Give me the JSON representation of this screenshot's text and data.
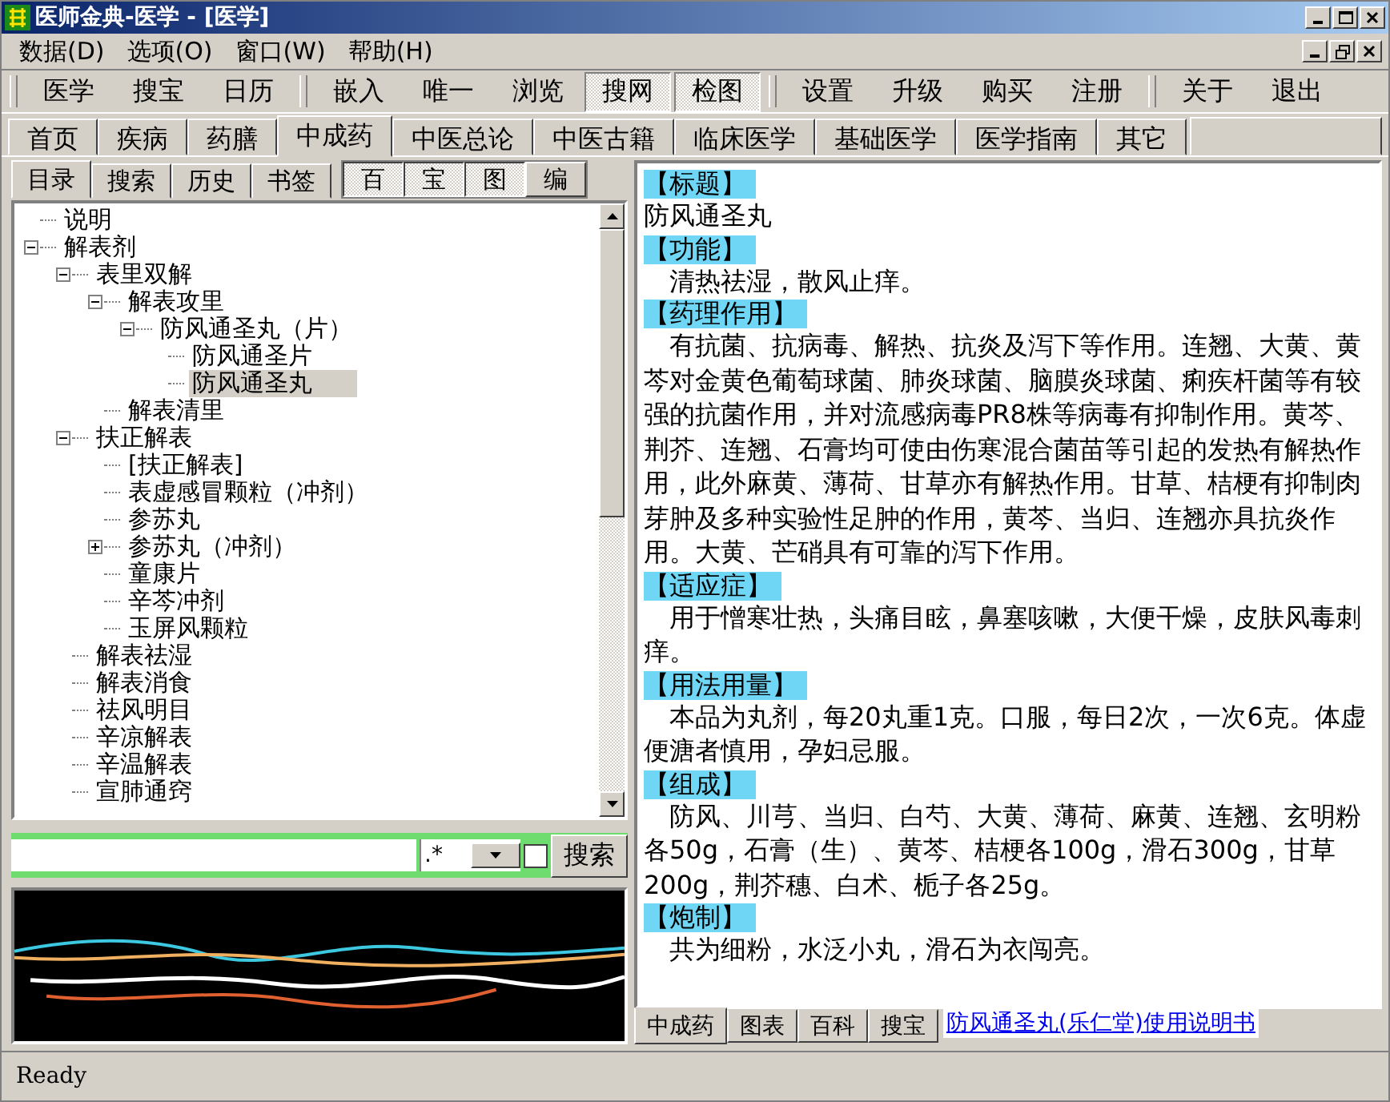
{
  "window": {
    "title": "医师金典-医学 - [医学]"
  },
  "menu": [
    "数据(D)",
    "选项(O)",
    "窗口(W)",
    "帮助(H)"
  ],
  "toolbar": {
    "groups": [
      {
        "buttons": [
          {
            "label": "医学",
            "pressed": false
          },
          {
            "label": "搜宝",
            "pressed": false
          },
          {
            "label": "日历",
            "pressed": false
          }
        ]
      },
      {
        "buttons": [
          {
            "label": "嵌入",
            "pressed": false
          },
          {
            "label": "唯一",
            "pressed": false
          },
          {
            "label": "浏览",
            "pressed": false
          },
          {
            "label": "搜网",
            "pressed": true
          },
          {
            "label": "检图",
            "pressed": true
          }
        ]
      },
      {
        "buttons": [
          {
            "label": "设置",
            "pressed": false
          },
          {
            "label": "升级",
            "pressed": false
          },
          {
            "label": "购买",
            "pressed": false
          },
          {
            "label": "注册",
            "pressed": false
          }
        ]
      },
      {
        "buttons": [
          {
            "label": "关于",
            "pressed": false
          },
          {
            "label": "退出",
            "pressed": false
          }
        ]
      }
    ]
  },
  "tabs": [
    {
      "label": "首页",
      "selected": false
    },
    {
      "label": "疾病",
      "selected": false
    },
    {
      "label": "药膳",
      "selected": false
    },
    {
      "label": "中成药",
      "selected": true
    },
    {
      "label": "中医总论",
      "selected": false
    },
    {
      "label": "中医古籍",
      "selected": false
    },
    {
      "label": "临床医学",
      "selected": false
    },
    {
      "label": "基础医学",
      "selected": false
    },
    {
      "label": "医学指南",
      "selected": false
    },
    {
      "label": "其它",
      "selected": false
    }
  ],
  "left_panel": {
    "tabs": [
      {
        "label": "目录",
        "selected": true
      },
      {
        "label": "搜索",
        "selected": false
      },
      {
        "label": "历史",
        "selected": false
      },
      {
        "label": "书签",
        "selected": false
      }
    ],
    "view_buttons": [
      {
        "label": "百",
        "pressed": true
      },
      {
        "label": "宝",
        "pressed": true
      },
      {
        "label": "图",
        "pressed": true
      },
      {
        "label": "编",
        "pressed": false
      }
    ],
    "tree": [
      {
        "label": "说明",
        "selected": false
      },
      {
        "label": "解表剂",
        "selected": false,
        "expanded": true,
        "children": [
          {
            "label": "表里双解",
            "selected": false,
            "expanded": true,
            "children": [
              {
                "label": "解表攻里",
                "selected": false,
                "expanded": true,
                "children": [
                  {
                    "label": "防风通圣丸（片）",
                    "selected": false,
                    "expanded": true,
                    "children": [
                      {
                        "label": "防风通圣片",
                        "selected": false
                      },
                      {
                        "label": "防风通圣丸",
                        "selected": true
                      }
                    ]
                  }
                ]
              },
              {
                "label": "解表清里",
                "selected": false
              }
            ]
          },
          {
            "label": "扶正解表",
            "selected": false,
            "expanded": true,
            "children": [
              {
                "label": "[扶正解表]",
                "selected": false
              },
              {
                "label": "表虚感冒颗粒（冲剂）",
                "selected": false
              },
              {
                "label": "参苏丸",
                "selected": false
              },
              {
                "label": "参苏丸（冲剂）",
                "selected": false,
                "expanded": false
              },
              {
                "label": "童康片",
                "selected": false
              },
              {
                "label": "辛芩冲剂",
                "selected": false
              },
              {
                "label": "玉屏风颗粒",
                "selected": false
              }
            ]
          },
          {
            "label": "解表祛湿",
            "selected": false
          },
          {
            "label": "解表消食",
            "selected": false
          },
          {
            "label": "祛风明目",
            "selected": false
          },
          {
            "label": "辛凉解表",
            "selected": false
          },
          {
            "label": "辛温解表",
            "selected": false
          },
          {
            "label": "宣肺通窍",
            "selected": false
          }
        ]
      }
    ],
    "search": {
      "pattern": ".*",
      "checked": false,
      "button": "搜索"
    }
  },
  "article": {
    "sections": [
      {
        "heading": "【标题】",
        "body": "防风通圣丸",
        "indented": false
      },
      {
        "heading": "【功能】",
        "body": "清热祛湿，散风止痒。",
        "indented": true
      },
      {
        "heading": "【药理作用】",
        "body": "有抗菌、抗病毒、解热、抗炎及泻下等作用。连翘、大黄、黄芩对金黄色葡萄球菌、肺炎球菌、脑膜炎球菌、痢疾杆菌等有较强的抗菌作用，并对流感病毒PR8株等病毒有抑制作用。黄芩、荆芥、连翘、石膏均可使由伤寒混合菌苗等引起的发热有解热作用，此外麻黄、薄荷、甘草亦有解热作用。甘草、桔梗有抑制肉芽肿及多种实验性足肿的作用，黄芩、当归、连翘亦具抗炎作用。大黄、芒硝具有可靠的泻下作用。",
        "indented": true
      },
      {
        "heading": "【适应症】",
        "body": "用于憎寒壮热，头痛目眩，鼻塞咳嗽，大便干燥，皮肤风毒刺痒。",
        "indented": true
      },
      {
        "heading": "【用法用量】",
        "body": "本品为丸剂，每20丸重1克。口服，每日2次，一次6克。体虚便溏者慎用，孕妇忌服。",
        "indented": true
      },
      {
        "heading": "【组成】",
        "body": "防风、川芎、当归、白芍、大黄、薄荷、麻黄、连翘、玄明粉各50g，石膏（生）、黄芩、桔梗各100g，滑石300g，甘草200g，荆芥穗、白术、栀子各25g。",
        "indented": true
      },
      {
        "heading": "【炮制】",
        "body": "共为细粉，水泛小丸，滑石为衣闯亮。",
        "indented": true
      }
    ]
  },
  "bottom_tabs": [
    {
      "label": "中成药",
      "selected": true
    },
    {
      "label": "图表",
      "selected": false
    },
    {
      "label": "百科",
      "selected": false
    },
    {
      "label": "搜宝",
      "selected": false
    }
  ],
  "link": "防风通圣丸(乐仁堂)使用说明书",
  "status_bar": "Ready"
}
